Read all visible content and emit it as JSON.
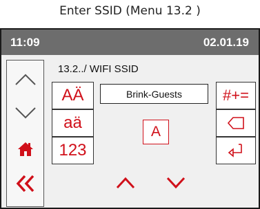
{
  "caption": "Enter SSID (Menu 13.2 )",
  "status": {
    "time": "11:09",
    "date": "02.01.19"
  },
  "screen": {
    "title": "13.2../ WIFI SSID"
  },
  "ssid_field": {
    "value": "Brink-Guests"
  },
  "keys_left": [
    "AÄ",
    "aä",
    "123"
  ],
  "keys_right": {
    "symbols": "#+=",
    "backspace_icon": "backspace-icon",
    "enter_icon": "enter-icon"
  },
  "selected_char": "A",
  "nav": {
    "up_icon": "chevron-up-icon",
    "down_icon": "chevron-down-icon",
    "home_icon": "home-icon",
    "back_icon": "double-chevron-left-icon"
  },
  "colors": {
    "accent": "#d0101a",
    "statusbar": "#6d6d6d",
    "background": "#f0f0f0"
  }
}
